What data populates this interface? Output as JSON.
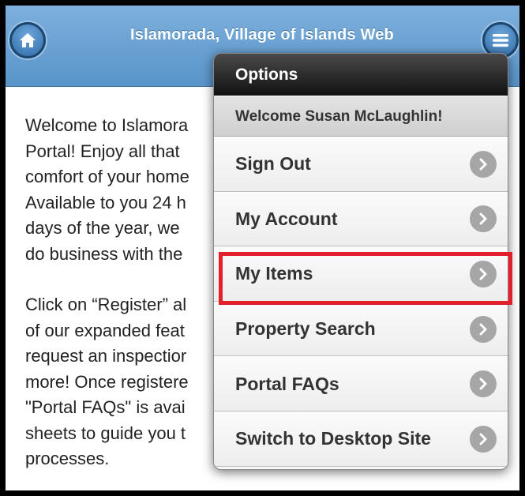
{
  "header": {
    "title": "Islamorada, Village of Islands Web",
    "home_icon": "home-icon",
    "menu_icon": "hamburger-menu-icon",
    "color": "#6ba3d6"
  },
  "body": {
    "paragraph1": "Welcome to Islamora\nPortal! Enjoy all that\ncomfort of your home\nAvailable to you 24 h\ndays of the year, we\ndo business with the",
    "paragraph2": "Click on “Register” al\nof our expanded feat\nrequest an inspectior\nmore! Once registere\n\"Portal FAQs\" is avai\nsheets to guide you t\nprocesses."
  },
  "options_menu": {
    "title": "Options",
    "welcome": "Welcome Susan McLaughlin!",
    "items": [
      {
        "label": "Sign Out"
      },
      {
        "label": "My Account"
      },
      {
        "label": "My Items"
      },
      {
        "label": "Property Search"
      },
      {
        "label": "Portal FAQs"
      },
      {
        "label": "Switch to Desktop Site"
      }
    ],
    "chevron_icon": "chevron-right-icon",
    "highlight_color": "#e2202a"
  }
}
